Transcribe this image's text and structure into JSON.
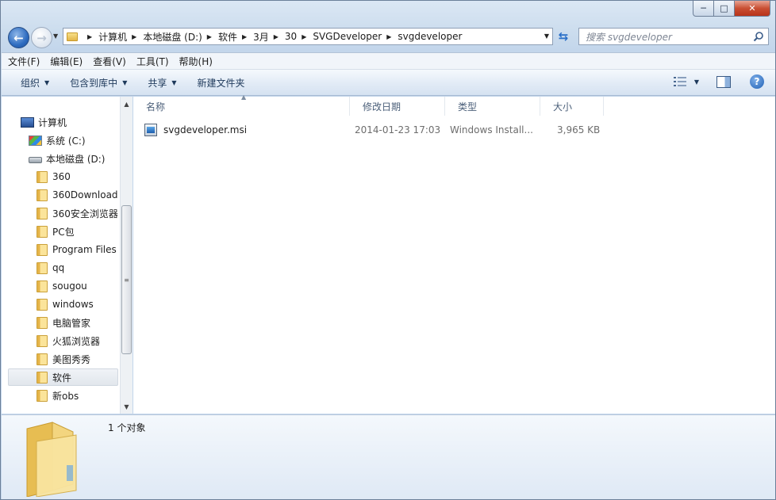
{
  "window": {
    "caption": {
      "minimize": "─",
      "maximize": "□",
      "close": "✕"
    }
  },
  "nav": {
    "back_glyph": "←",
    "forward_glyph": "→",
    "breadcrumbs": [
      "计算机",
      "本地磁盘 (D:)",
      "软件",
      "3月",
      "30",
      "SVGDeveloper",
      "svgdeveloper"
    ],
    "refresh_glyph": "⇆",
    "search_placeholder": "搜索 svgdeveloper"
  },
  "menu": [
    "文件(F)",
    "编辑(E)",
    "查看(V)",
    "工具(T)",
    "帮助(H)"
  ],
  "commands": [
    {
      "label": "组织",
      "has_dropdown": true
    },
    {
      "label": "包含到库中",
      "has_dropdown": true
    },
    {
      "label": "共享",
      "has_dropdown": true
    },
    {
      "label": "新建文件夹",
      "has_dropdown": false
    }
  ],
  "help_glyph": "?",
  "tree": [
    {
      "label": "计算机",
      "icon": "computer-icon",
      "indent": 0
    },
    {
      "label": "系统 (C:)",
      "icon": "drive-c-icon",
      "indent": 1
    },
    {
      "label": "本地磁盘 (D:)",
      "icon": "drive-d-icon",
      "indent": 1
    },
    {
      "label": "360",
      "icon": "folder-icon",
      "indent": 2
    },
    {
      "label": "360Download",
      "icon": "folder-icon",
      "indent": 2
    },
    {
      "label": "360安全浏览器",
      "icon": "folder-icon",
      "indent": 2
    },
    {
      "label": "PC包",
      "icon": "folder-icon",
      "indent": 2
    },
    {
      "label": "Program Files",
      "icon": "folder-icon",
      "indent": 2
    },
    {
      "label": "qq",
      "icon": "folder-icon",
      "indent": 2
    },
    {
      "label": "sougou",
      "icon": "folder-icon",
      "indent": 2
    },
    {
      "label": "windows",
      "icon": "folder-icon",
      "indent": 2
    },
    {
      "label": "电脑管家",
      "icon": "folder-icon",
      "indent": 2
    },
    {
      "label": "火狐浏览器",
      "icon": "folder-icon",
      "indent": 2
    },
    {
      "label": "美图秀秀",
      "icon": "folder-icon",
      "indent": 2
    },
    {
      "label": "软件",
      "icon": "folder-icon",
      "indent": 2,
      "selected": true
    },
    {
      "label": "新obs",
      "icon": "folder-icon",
      "indent": 2
    }
  ],
  "columns": [
    "名称",
    "修改日期",
    "类型",
    "大小"
  ],
  "files": [
    {
      "name": "svgdeveloper.msi",
      "modified": "2014-01-23 17:03",
      "type": "Windows Install...",
      "size": "3,965 KB"
    }
  ],
  "details": {
    "count_text": "1 个对象"
  },
  "colors": {
    "accent": "#2e6cc0",
    "close": "#c94f33",
    "folder": "#e8c058"
  }
}
